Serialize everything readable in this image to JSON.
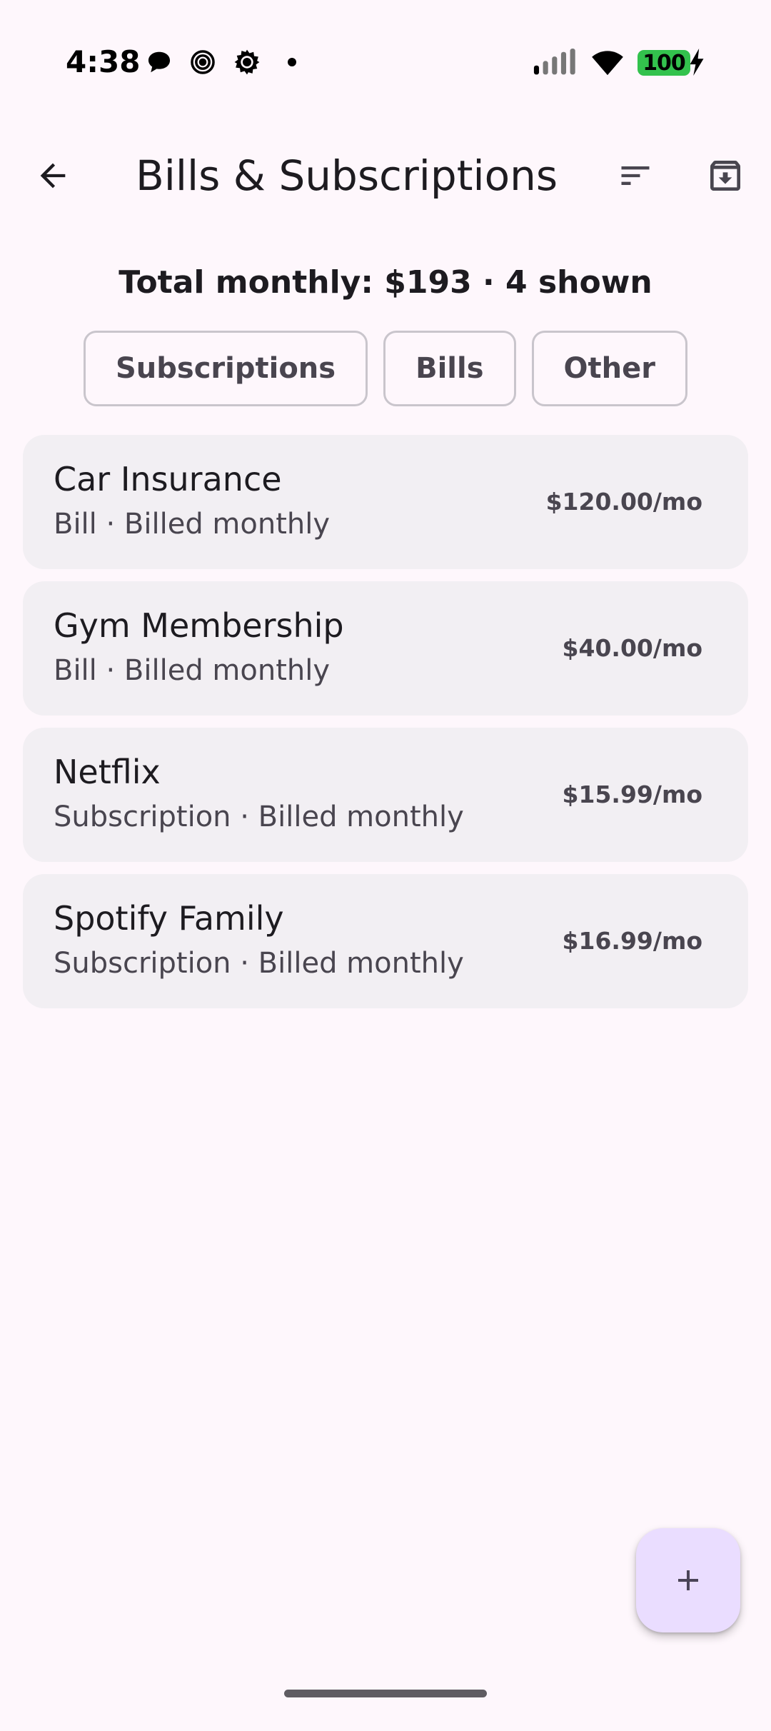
{
  "status_bar": {
    "time": "4:38",
    "battery": "100",
    "icons": [
      "chat-bubble-icon",
      "spiral-icon",
      "sun-icon",
      "dot-icon",
      "signal-icon",
      "wifi-icon",
      "battery-icon",
      "charging-bolt-icon"
    ]
  },
  "app_bar": {
    "title": "Bills & Subscriptions",
    "back_icon": "arrow-back-icon",
    "sort_icon": "sort-icon",
    "archive_icon": "archive-download-icon"
  },
  "summary": {
    "text": "Total monthly: $193 · 4 shown"
  },
  "filters": [
    {
      "label": "Subscriptions"
    },
    {
      "label": "Bills"
    },
    {
      "label": "Other"
    }
  ],
  "items": [
    {
      "name": "Car Insurance",
      "meta": "Bill · Billed monthly",
      "amount": "$120.00/mo"
    },
    {
      "name": "Gym Membership",
      "meta": "Bill · Billed monthly",
      "amount": "$40.00/mo"
    },
    {
      "name": "Netflix",
      "meta": "Subscription · Billed monthly",
      "amount": "$15.99/mo"
    },
    {
      "name": "Spotify Family",
      "meta": "Subscription · Billed monthly",
      "amount": "$16.99/mo"
    }
  ],
  "fab": {
    "icon": "plus-icon"
  },
  "colors": {
    "background": "#FEF7FC",
    "card": "#F2EFF3",
    "fab": "#EADDFF",
    "battery": "#33C24D",
    "text_primary": "#1D1B20",
    "text_secondary": "#49454F"
  }
}
